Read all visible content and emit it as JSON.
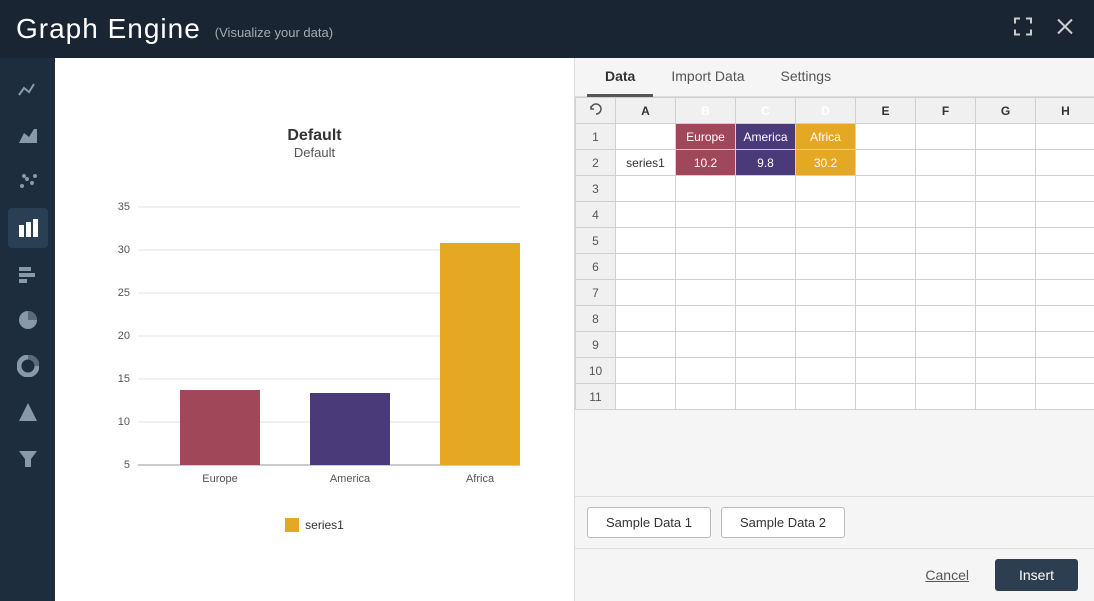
{
  "header": {
    "title": "Graph Engine",
    "subtitle": "(Visualize your data)"
  },
  "sidebar": {
    "icons": [
      {
        "name": "line-chart-icon",
        "symbol": "〜"
      },
      {
        "name": "area-chart-icon",
        "symbol": "▲"
      },
      {
        "name": "scatter-icon",
        "symbol": "⠿"
      },
      {
        "name": "bar-chart-icon",
        "symbol": "▐",
        "active": true
      },
      {
        "name": "horizontal-bar-icon",
        "symbol": "≡"
      },
      {
        "name": "pie-icon",
        "symbol": "●"
      },
      {
        "name": "donut-icon",
        "symbol": "◎"
      },
      {
        "name": "triangle-icon",
        "symbol": "▲"
      },
      {
        "name": "funnel-icon",
        "symbol": "⌥"
      }
    ]
  },
  "chart": {
    "title": "Default",
    "subtitle": "Default",
    "bars": [
      {
        "label": "Europe",
        "value": 10.2,
        "color": "#a0475a"
      },
      {
        "label": "America",
        "value": 9.8,
        "color": "#4a3a7a"
      },
      {
        "label": "Africa",
        "value": 30.2,
        "color": "#e5a823"
      }
    ],
    "yMax": 35,
    "legend": "series1"
  },
  "tabs": [
    {
      "label": "Data",
      "active": true
    },
    {
      "label": "Import Data",
      "active": false
    },
    {
      "label": "Settings",
      "active": false
    }
  ],
  "spreadsheet": {
    "columns": [
      "",
      "A",
      "B",
      "C",
      "D",
      "E",
      "F",
      "G",
      "H"
    ],
    "rows": [
      {
        "num": 1,
        "A": "",
        "B": "Europe",
        "C": "America",
        "D": "Africa",
        "E": "",
        "F": "",
        "G": "",
        "H": ""
      },
      {
        "num": 2,
        "A": "series1",
        "B": "10.2",
        "C": "9.8",
        "D": "30.2",
        "E": "",
        "F": "",
        "G": "",
        "H": ""
      },
      {
        "num": 3,
        "A": "",
        "B": "",
        "C": "",
        "D": "",
        "E": "",
        "F": "",
        "G": "",
        "H": ""
      },
      {
        "num": 4,
        "A": "",
        "B": "",
        "C": "",
        "D": "",
        "E": "",
        "F": "",
        "G": "",
        "H": ""
      },
      {
        "num": 5,
        "A": "",
        "B": "",
        "C": "",
        "D": "",
        "E": "",
        "F": "",
        "G": "",
        "H": ""
      },
      {
        "num": 6,
        "A": "",
        "B": "",
        "C": "",
        "D": "",
        "E": "",
        "F": "",
        "G": "",
        "H": ""
      },
      {
        "num": 7,
        "A": "",
        "B": "",
        "C": "",
        "D": "",
        "E": "",
        "F": "",
        "G": "",
        "H": ""
      },
      {
        "num": 8,
        "A": "",
        "B": "",
        "C": "",
        "D": "",
        "E": "",
        "F": "",
        "G": "",
        "H": ""
      },
      {
        "num": 9,
        "A": "",
        "B": "",
        "C": "",
        "D": "",
        "E": "",
        "F": "",
        "G": "",
        "H": ""
      },
      {
        "num": 10,
        "A": "",
        "B": "",
        "C": "",
        "D": "",
        "E": "",
        "F": "",
        "G": "",
        "H": ""
      },
      {
        "num": 11,
        "A": "",
        "B": "",
        "C": "",
        "D": "",
        "E": "",
        "F": "",
        "G": "",
        "H": ""
      }
    ]
  },
  "buttons": {
    "sample1": "Sample Data 1",
    "sample2": "Sample Data 2",
    "cancel": "Cancel",
    "insert": "Insert"
  }
}
